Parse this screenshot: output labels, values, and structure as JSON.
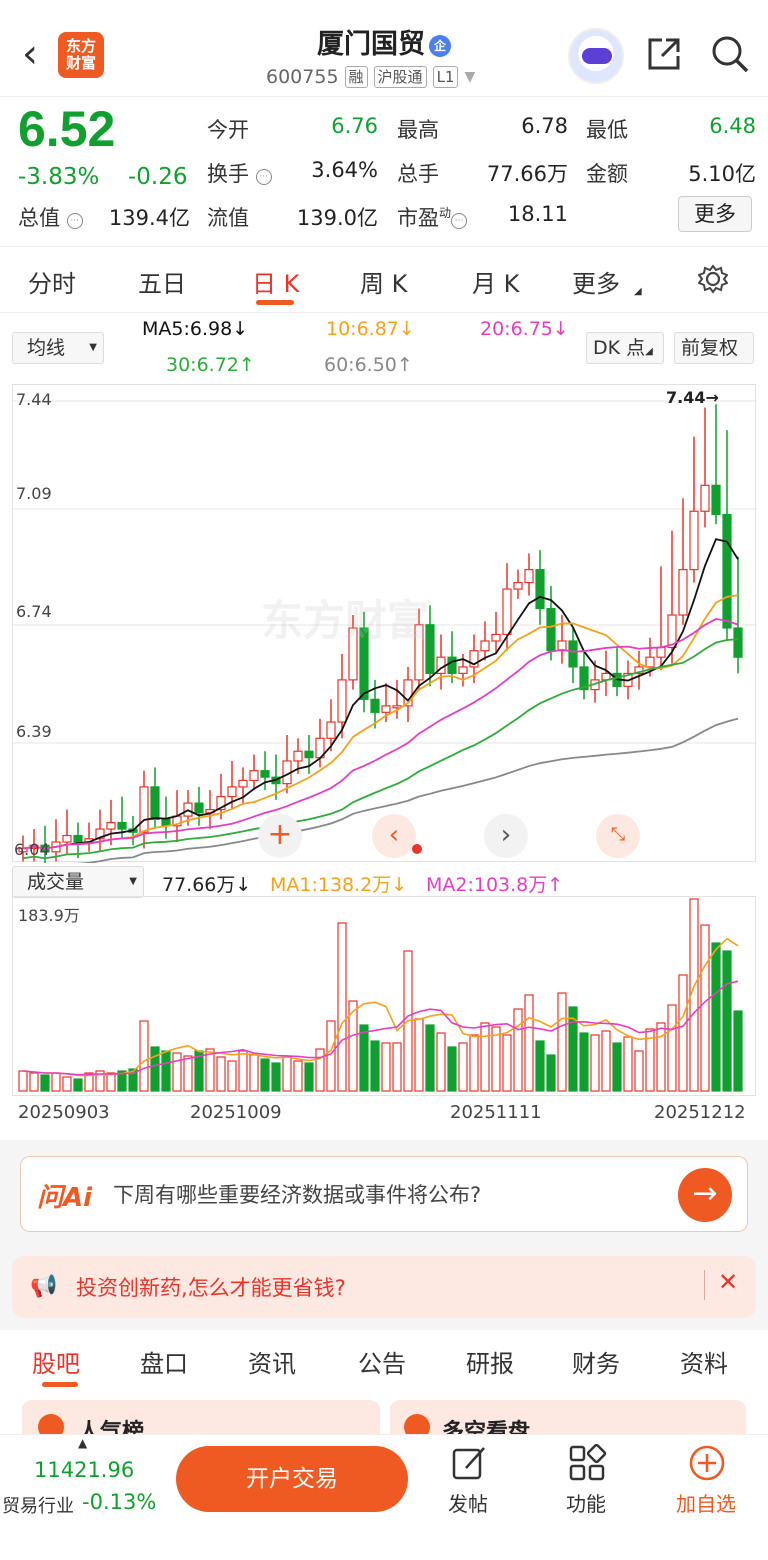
{
  "header": {
    "logo_text": "东方财富",
    "title": "厦门国贸",
    "badge": "企",
    "code": "600755",
    "tags": [
      "融",
      "沪股通",
      "L1"
    ]
  },
  "quote": {
    "price": "6.52",
    "pct": "-3.83%",
    "change": "-0.26",
    "rows": [
      [
        {
          "label": "今开",
          "value": "6.76",
          "color": "green"
        },
        {
          "label": "最高",
          "value": "6.78",
          "color": "normal"
        },
        {
          "label": "最低",
          "value": "6.48",
          "color": "green"
        }
      ],
      [
        {
          "label": "换手",
          "value": "3.64%",
          "color": "normal"
        },
        {
          "label": "总手",
          "value": "77.66万",
          "color": "normal"
        },
        {
          "label": "金额",
          "value": "5.10亿",
          "color": "normal"
        }
      ],
      [
        {
          "label": "流值",
          "value": "139.0亿",
          "color": "normal"
        },
        {
          "label": "市盈",
          "value": "18.11",
          "color": "normal"
        }
      ]
    ],
    "total_label": "总值",
    "total_value": "139.4亿",
    "pe_super": "动",
    "more": "更多"
  },
  "tabs": [
    "分时",
    "五日",
    "日 K",
    "周 K",
    "月 K",
    "更多"
  ],
  "active_tab": "日 K",
  "ma": {
    "selector": "均线",
    "ma5": "MA5:6.98",
    "ma10": "10:6.87",
    "ma20": "20:6.75",
    "ma30": "30:6.72",
    "ma60": "60:6.50",
    "dk": "DK 点",
    "fq": "前复权"
  },
  "colors": {
    "up": "#e8342b",
    "down": "#11a02f",
    "ma5": "#111111",
    "ma10": "#f4a21e",
    "ma20": "#e43fc2",
    "ma30": "#2fab3b",
    "ma60": "#888888",
    "accent": "#ef5a22"
  },
  "chart_data": {
    "type": "candlestick",
    "y_ticks": [
      "7.44",
      "7.09",
      "6.74",
      "6.39"
    ],
    "max_label": "7.44",
    "min_label": "6.04",
    "dates": [
      "20250903",
      "20251009",
      "20251111",
      "20251212"
    ],
    "volume": {
      "selector": "成交量",
      "vol": "77.66万",
      "ma1": "MA1:138.2万",
      "ma2": "MA2:103.8万",
      "max_label": "183.9万"
    }
  },
  "ai": {
    "label": "问Ai",
    "question": "下周有哪些重要经济数据或事件将公布?"
  },
  "notice": "投资创新药,怎么才能更省钱?",
  "bottom_tabs": [
    "股吧",
    "盘口",
    "资讯",
    "公告",
    "研报",
    "财务",
    "资料"
  ],
  "bottom_bar": {
    "index_value": "11421.96",
    "index_name": "贸易行业",
    "index_change": "-0.13%",
    "trade": "开户交易",
    "post": "发帖",
    "func": "功能",
    "watch": "加自选"
  },
  "preview": [
    "人气榜",
    "多空看盘"
  ]
}
